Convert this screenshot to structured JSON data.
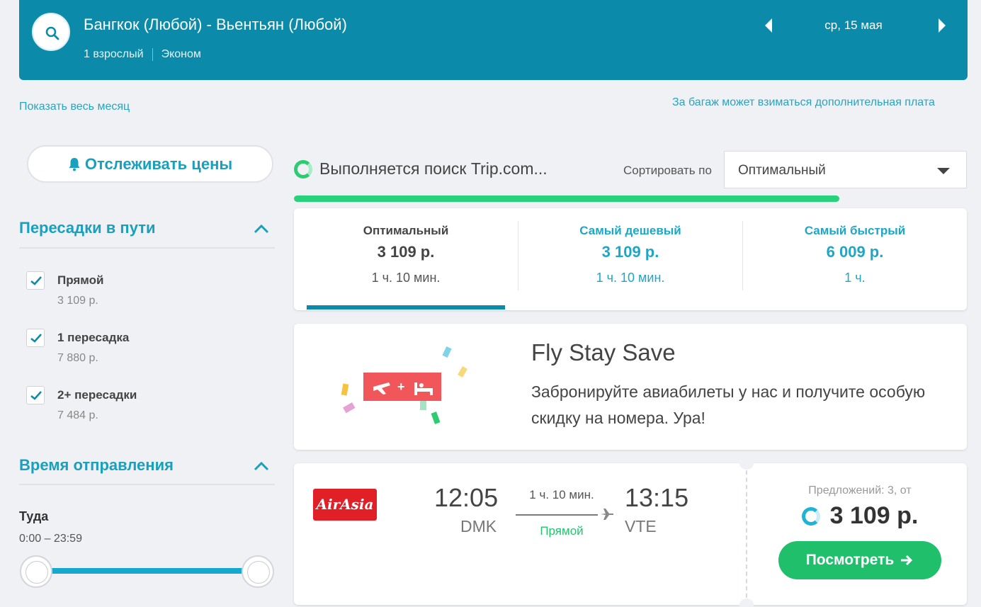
{
  "header": {
    "route": "Бангкок (Любой) - Вьентьян (Любой)",
    "passengers": "1 взрослый",
    "cabin_class": "Эконом",
    "date": "ср, 15 мая"
  },
  "links": {
    "show_month": "Показать весь месяц",
    "baggage_note": "За багаж может взиматься дополнительная плата"
  },
  "sidebar": {
    "track_prices": "Отслеживать цены",
    "stops": {
      "title": "Пересадки в пути",
      "options": [
        {
          "label": "Прямой",
          "price": "3 109 р.",
          "checked": true
        },
        {
          "label": "1 пересадка",
          "price": "7 880 р.",
          "checked": true
        },
        {
          "label": "2+ пересадки",
          "price": "7 484 р.",
          "checked": true
        }
      ]
    },
    "departure_time": {
      "title": "Время отправления",
      "direction": "Туда",
      "range": "0:00 – 23:59"
    }
  },
  "search_status": {
    "text": "Выполняется поиск Trip.com...",
    "progress": 0.81
  },
  "sort": {
    "label": "Сортировать по",
    "selected": "Оптимальный"
  },
  "sort_tabs": [
    {
      "title": "Оптимальный",
      "price": "3 109 р.",
      "duration": "1 ч. 10 мин.",
      "active": true
    },
    {
      "title": "Самый дешевый",
      "price": "3 109 р.",
      "duration": "1 ч. 10 мин.",
      "active": false
    },
    {
      "title": "Самый быстрый",
      "price": "6 009 р.",
      "duration": "1 ч.",
      "active": false
    }
  ],
  "promo": {
    "title": "Fly Stay Save",
    "text": "Забронируйте авиабилеты у нас и получите особую скидку на номера. Ура!"
  },
  "flight": {
    "airline_logo": "AirAsia",
    "depart_time": "12:05",
    "depart_airport": "DMK",
    "arrive_time": "13:15",
    "arrive_airport": "VTE",
    "duration": "1 ч. 10 мин.",
    "stops": "Прямой",
    "offers": "Предложений: 3, от",
    "price": "3 109 р.",
    "view_button": "Посмотреть"
  },
  "colors": {
    "header_bg": "#0b8ba9",
    "accent_teal": "#1a9fbd",
    "success_green": "#1fbf6c",
    "airline_red": "#e01f26"
  }
}
